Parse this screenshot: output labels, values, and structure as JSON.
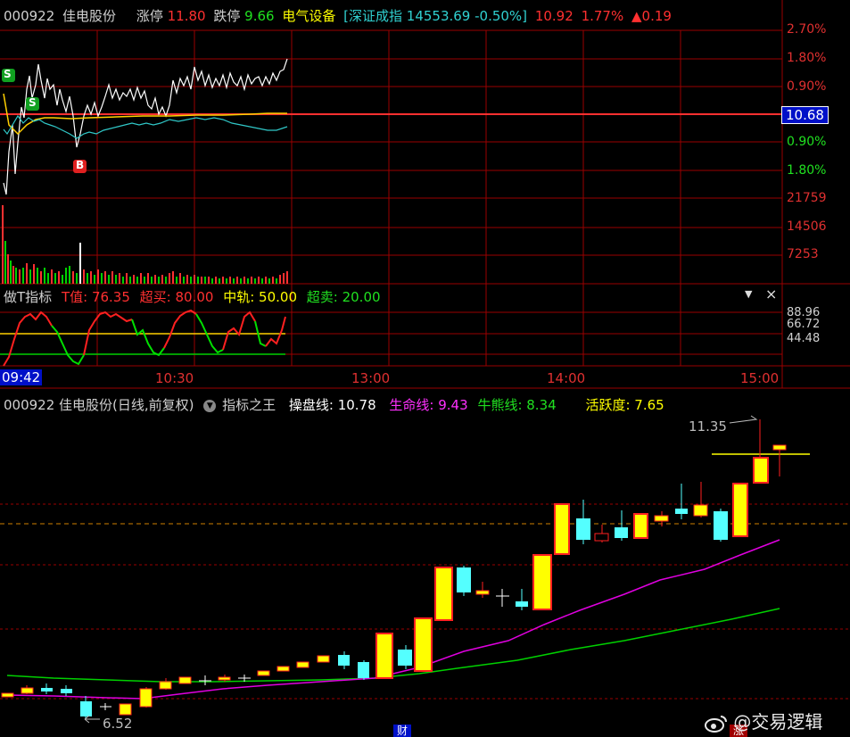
{
  "intraday": {
    "code": "000922",
    "name": "佳电股份",
    "limit_up_label": "涨停",
    "limit_up_value": "11.80",
    "limit_down_label": "跌停",
    "limit_down_value": "9.66",
    "sector": "电气设备",
    "index_info": "[深证成指 14553.69 -0.50%]",
    "price": "10.92",
    "change_pct": "1.77%",
    "change_amount": "▲0.19",
    "right_axis_up": [
      "2.70%",
      "1.80%",
      "0.90%"
    ],
    "current_price": "10.68",
    "right_axis_down": [
      "0.90%",
      "1.80%"
    ],
    "volume_axis": [
      "21759",
      "14506",
      "7253"
    ],
    "markers": [
      "S",
      "S",
      "B"
    ]
  },
  "oscillator": {
    "title": "做T指标",
    "t_value": "T值: 76.35",
    "overbought": "超买: 80.00",
    "middle": "中轨: 50.00",
    "oversold": "超卖: 20.00",
    "axis": [
      "88.96",
      "66.72",
      "44.48"
    ],
    "dropdown_icon": "▼",
    "close_icon": "×"
  },
  "time_axis": {
    "current": "09:42",
    "labels": [
      "10:30",
      "13:00",
      "14:00",
      "15:00"
    ]
  },
  "daily": {
    "title": "000922 佳电股份(日线,前复权)",
    "indicator_name": "指标之王",
    "line1": "操盘线: 10.78",
    "line2": "生命线: 9.43",
    "line3": "牛熊线: 8.34",
    "line4": "活跃度: 7.65",
    "high_label": "11.35",
    "low_label": "6.52",
    "marker_cai": "财",
    "marker_zhang": "涨"
  },
  "watermark": "@交易逻辑",
  "colors": {
    "up": "#ff2020",
    "down": "#54ffff",
    "yellow": "#ffff00",
    "grid": "#a00000",
    "magenta": "#ff00ff",
    "green": "#00e000"
  }
}
